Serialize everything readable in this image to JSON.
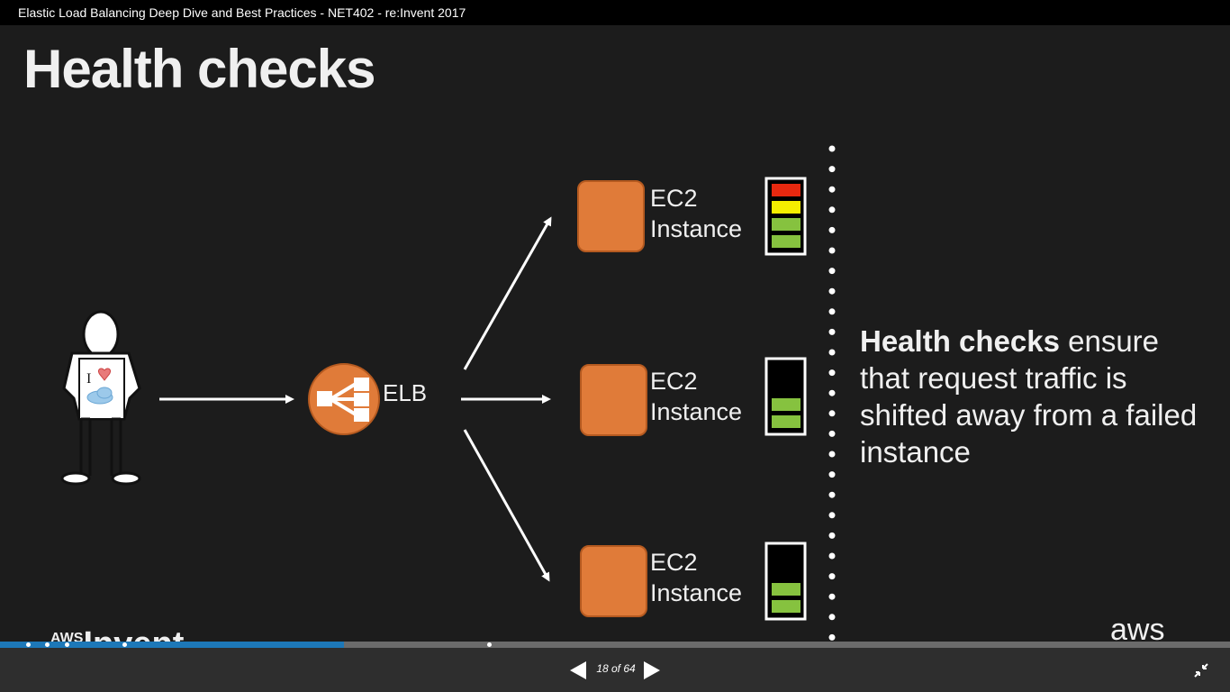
{
  "window": {
    "title": "Elastic Load Balancing Deep Dive and Best Practices - NET402 - re:Invent 2017"
  },
  "slide": {
    "title": "Health checks",
    "elb_label": "ELB",
    "instances": [
      {
        "line1": "EC2",
        "line2": "Instance",
        "health_levels": [
          "red",
          "yellow",
          "green",
          "green"
        ]
      },
      {
        "line1": "EC2",
        "line2": "Instance",
        "health_levels": [
          "green",
          "green"
        ]
      },
      {
        "line1": "EC2",
        "line2": "Instance",
        "health_levels": [
          "green",
          "green"
        ]
      }
    ],
    "callout": {
      "bold": "Health checks",
      "rest": " ensure that request traffic is shifted away from a failed instance"
    },
    "footer": {
      "reinvent_aws": "AWS",
      "reinvent_word": "Invent",
      "aws_logo": "aws"
    }
  },
  "player": {
    "progress_fraction": 0.28,
    "slide_counter": "18 of 64",
    "icons": {
      "prev": "triangle-left-icon",
      "next": "triangle-right-icon",
      "exit_fullscreen": "compress-arrows-icon"
    }
  },
  "colors": {
    "orange": "#e07b39",
    "health_red": "#e8280f",
    "health_yellow": "#f5ee00",
    "health_green": "#86c23f",
    "progress": "#1d78b8"
  }
}
